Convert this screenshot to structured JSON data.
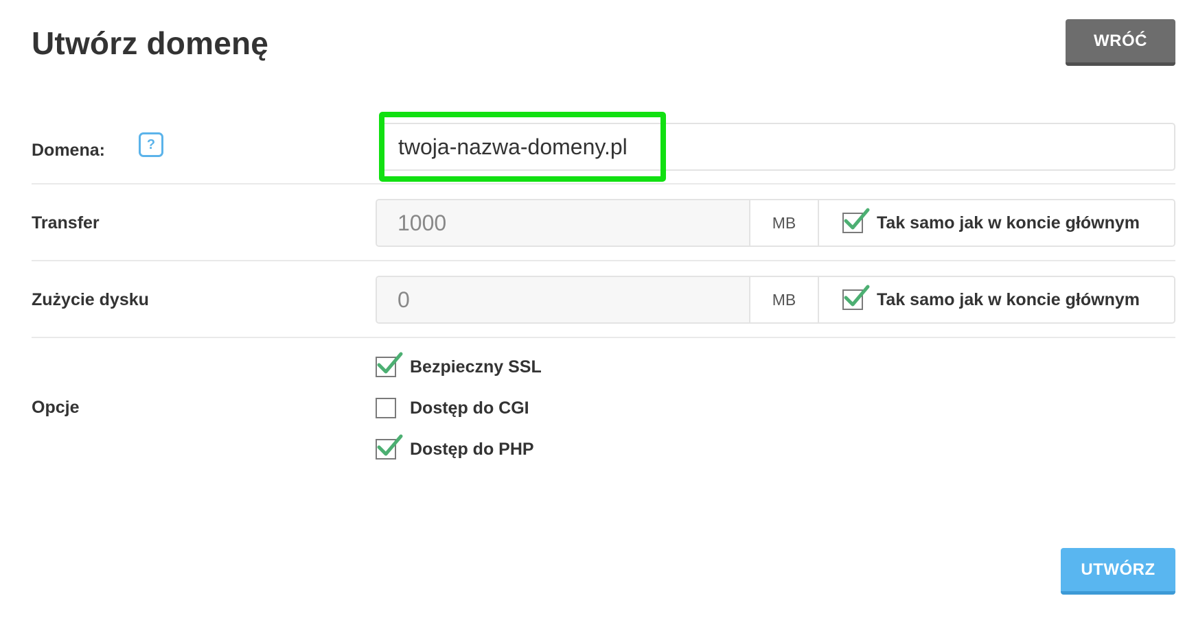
{
  "page": {
    "title": "Utwórz domenę",
    "back_button": "WRÓĆ",
    "submit_button": "UTWÓRZ"
  },
  "colors": {
    "back_button": "#6d6d6d",
    "submit_button": "#59b6f0",
    "highlight": "#11e011",
    "check_mark": "#4caf72",
    "help_icon": "#5bb3ea"
  },
  "form": {
    "domain": {
      "label": "Domena:",
      "help_icon": "question-icon",
      "help_text": "?",
      "value": "twoja-nazwa-domeny.pl",
      "highlighted": true
    },
    "transfer": {
      "label": "Transfer",
      "value": "1000",
      "unit": "MB",
      "same_as_main_checked": true,
      "same_as_main_label": "Tak samo jak w koncie głównym"
    },
    "disk": {
      "label": "Zużycie dysku",
      "value": "0",
      "unit": "MB",
      "same_as_main_checked": true,
      "same_as_main_label": "Tak samo jak w koncie głównym"
    },
    "options": {
      "label": "Opcje",
      "items": [
        {
          "label": "Bezpieczny SSL",
          "checked": true
        },
        {
          "label": "Dostęp do CGI",
          "checked": false
        },
        {
          "label": "Dostęp do PHP",
          "checked": true
        }
      ]
    }
  }
}
